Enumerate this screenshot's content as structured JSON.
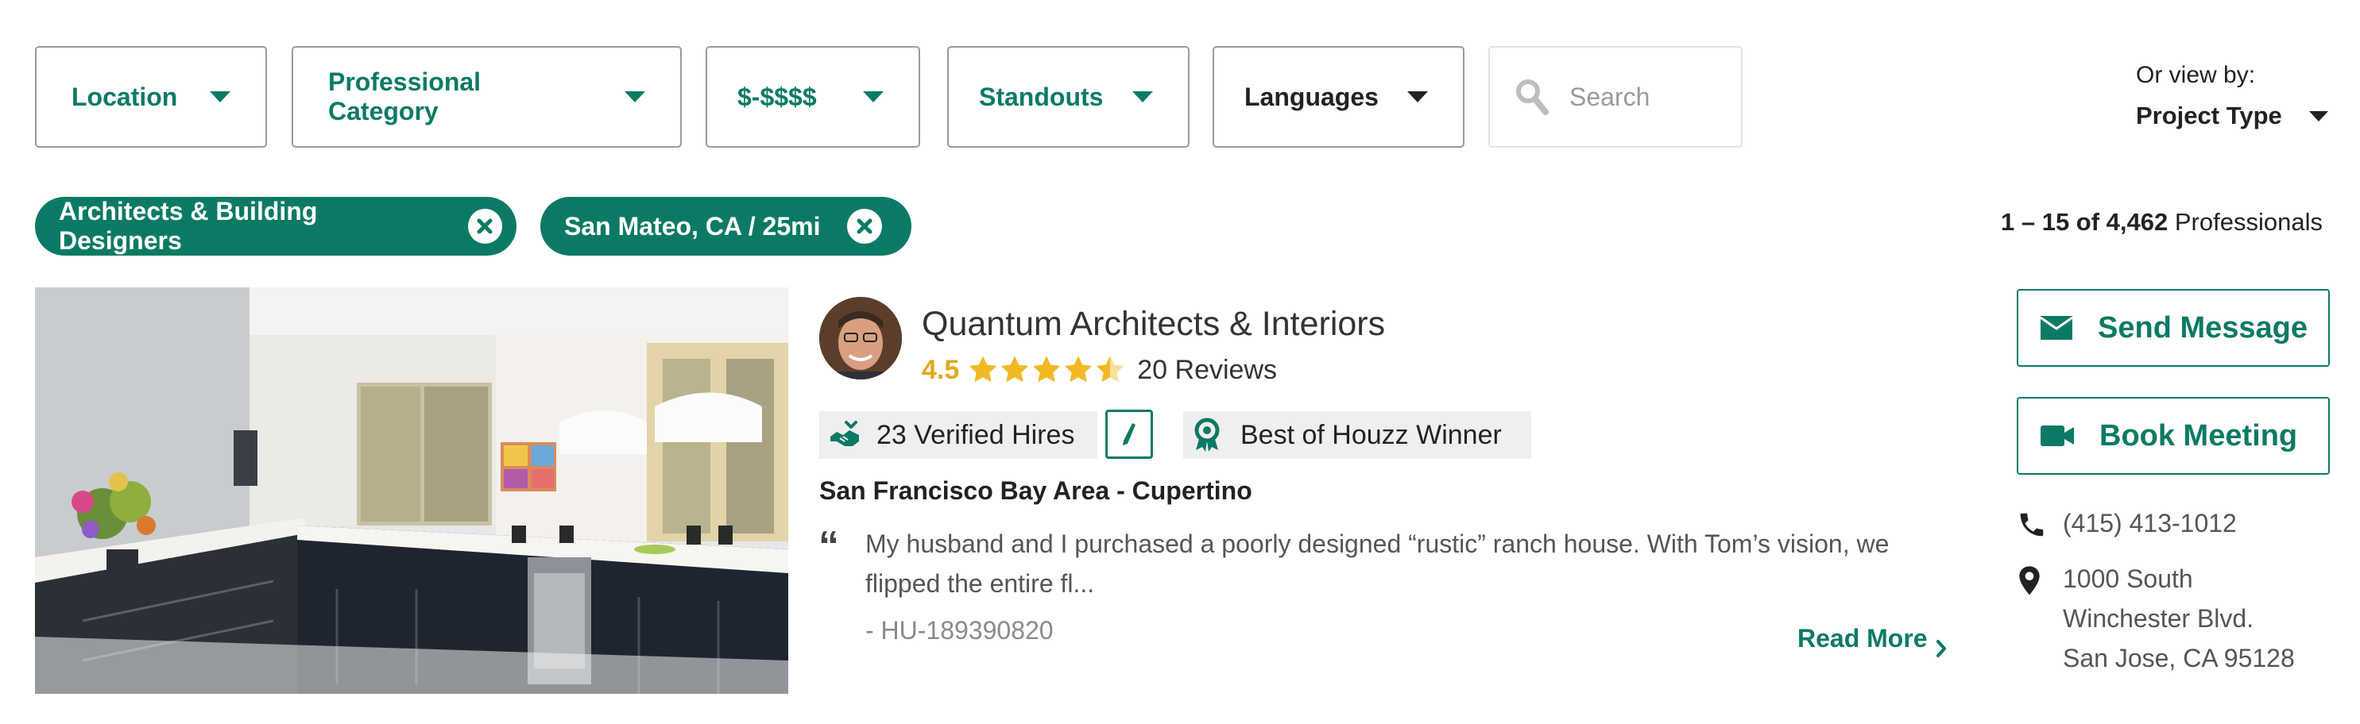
{
  "filters": {
    "location": "Location",
    "professional_category": "Professional Category",
    "price": "$-$$$$",
    "standouts": "Standouts",
    "languages": "Languages"
  },
  "search": {
    "placeholder": "Search"
  },
  "view_by": {
    "label": "Or view by:",
    "value": "Project Type"
  },
  "active_chips": [
    {
      "label": "Architects & Building Designers"
    },
    {
      "label": "San Mateo, CA / 25mi"
    }
  ],
  "results": {
    "range": "1 – 15 of 4,462",
    "suffix": " Professionals"
  },
  "listing": {
    "name": "Quantum Architects & Interiors",
    "rating": "4.5",
    "rating_value": 4.5,
    "reviews": "20 Reviews",
    "verified_hires": "23 Verified Hires",
    "award": "Best of Houzz Winner",
    "location": "San Francisco Bay Area - Cupertino",
    "quote": "My husband and I purchased a poorly designed “rustic” ranch house. With Tom’s vision, we flipped the entire fl...",
    "quote_author": "- HU-189390820",
    "read_more": "Read More"
  },
  "actions": {
    "send_message": "Send Message",
    "book_meeting": "Book Meeting"
  },
  "contact": {
    "phone": "(415) 413-1012",
    "address_line1": "1000 South",
    "address_line2": "Winchester Blvd.",
    "address_line3": "San Jose, CA 95128"
  },
  "colors": {
    "accent": "#0b7a64",
    "star": "#f2b824",
    "rating_text": "#e0a91e"
  },
  "icons": [
    "chevron-down-icon",
    "search-icon",
    "close-icon",
    "star-icon",
    "handshake-icon",
    "edit-icon",
    "award-icon",
    "quote-icon",
    "chevron-right-icon",
    "mail-icon",
    "video-icon",
    "phone-icon",
    "map-pin-icon"
  ]
}
